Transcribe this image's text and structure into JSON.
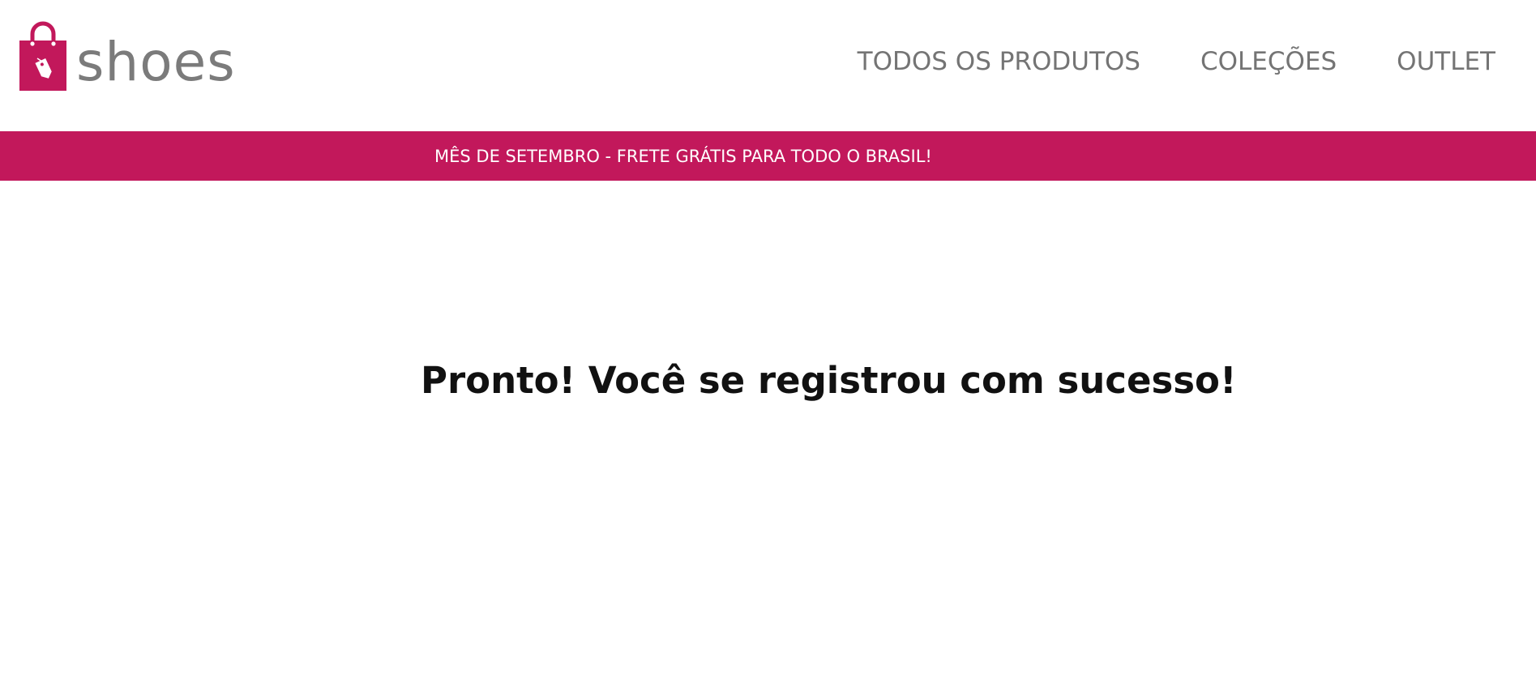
{
  "brand": {
    "name": "shoes",
    "logo_icon": "shopping-bag-with-tag-icon",
    "accent_color": "#c2185b"
  },
  "nav": {
    "items": [
      {
        "label": "TODOS OS PRODUTOS"
      },
      {
        "label": "COLEÇÕES"
      },
      {
        "label": "OUTLET"
      }
    ]
  },
  "banner": {
    "text": "MÊS DE SETEMBRO - FRETE GRÁTIS PARA TODO O BRASIL!",
    "background_color": "#c2185b"
  },
  "main": {
    "message": "Pronto! Você se registrou com sucesso!"
  }
}
